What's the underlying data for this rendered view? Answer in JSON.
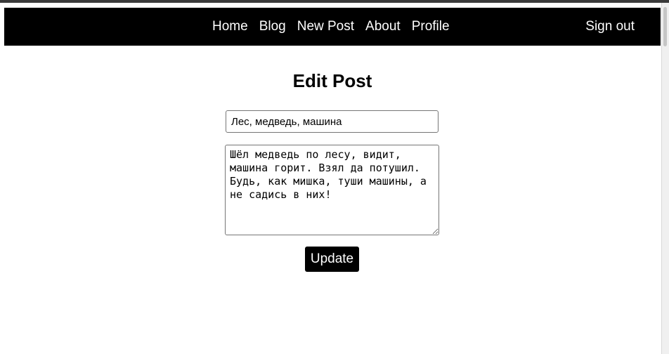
{
  "nav": {
    "links": [
      {
        "label": "Home"
      },
      {
        "label": "Blog"
      },
      {
        "label": "New Post"
      },
      {
        "label": "About"
      },
      {
        "label": "Profile"
      }
    ],
    "sign_out": "Sign out"
  },
  "page": {
    "title": "Edit Post"
  },
  "form": {
    "title_value": "Лес, медведь, машина",
    "body_value": "Шёл медведь по лесу, видит, машина горит. Взял да потушил. Будь, как мишка, туши машины, а не садись в них!",
    "submit_label": "Update"
  },
  "colors": {
    "nav_bg": "#000000",
    "nav_text": "#ffffff",
    "button_bg": "#000000",
    "button_text": "#ffffff"
  }
}
